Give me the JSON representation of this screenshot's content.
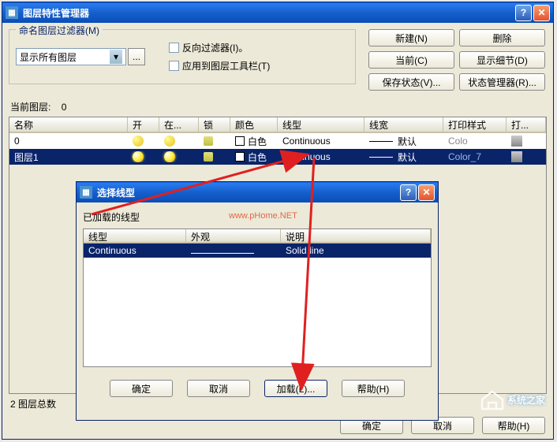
{
  "mainWindow": {
    "title": "图层特性管理器",
    "filterGroup": {
      "legend": "命名图层过滤器(M)",
      "dropdownValue": "显示所有图层",
      "invertFilter": "反向过滤器(I)。",
      "applyToToolbar": "应用到图层工具栏(T)"
    },
    "buttons": {
      "new": "新建(N)",
      "delete": "删除",
      "current": "当前(C)",
      "showDetail": "显示细节(D)",
      "saveState": "保存状态(V)...",
      "stateManager": "状态管理器(R)..."
    },
    "currentLayer": {
      "label": "当前图层:",
      "value": "0"
    },
    "headers": {
      "name": "名称",
      "on": "开",
      "freeze": "在...",
      "lock": "锁",
      "color": "颜色",
      "linetype": "线型",
      "lineweight": "线宽",
      "plotstyle": "打印样式",
      "plot": "打..."
    },
    "rows": [
      {
        "name": "0",
        "color": "白色",
        "linetype": "Continuous",
        "lineweight": "默认",
        "plotstyle": "Colo"
      },
      {
        "name": "图层1",
        "color": "白色",
        "linetype": "Continuous",
        "lineweight": "默认",
        "plotstyle": "Color_7"
      }
    ],
    "footer": {
      "totalLabel": "2 图层总数"
    },
    "bottomButtons": {
      "ok": "确定",
      "cancel": "取消",
      "help": "帮助(H)"
    }
  },
  "dialog": {
    "title": "选择线型",
    "loadedLabel": "已加载的线型",
    "headers": {
      "linetype": "线型",
      "appearance": "外观",
      "description": "说明"
    },
    "row": {
      "linetype": "Continuous",
      "description": "Solid line"
    },
    "buttons": {
      "ok": "确定",
      "cancel": "取消",
      "load": "加载(L)...",
      "help": "帮助(H)"
    }
  },
  "watermark": "www.pHome.NET",
  "logoText": "系统之家"
}
